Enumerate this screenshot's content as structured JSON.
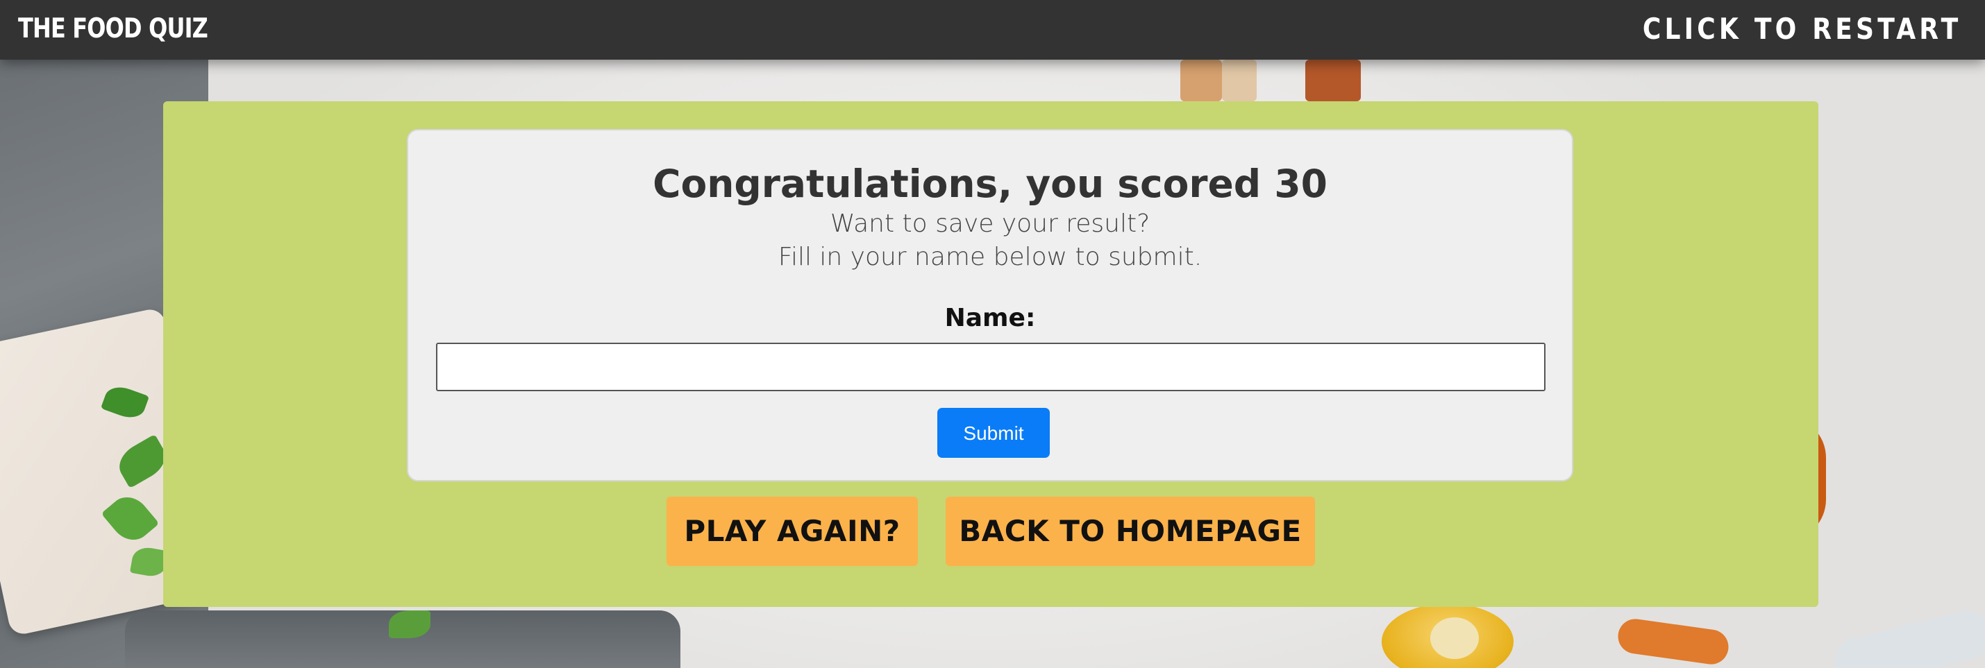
{
  "navbar": {
    "brand": "THE FOOD QUIZ",
    "restart_label": "CLICK TO RESTART"
  },
  "result": {
    "title": "Congratulations, you scored 30",
    "line1": "Want to save your result?",
    "line2": "Fill in your name below to submit.",
    "name_label": "Name:",
    "name_value": "",
    "submit_label": "Submit"
  },
  "actions": {
    "play_again": "PLAY AGAIN?",
    "back_home": "BACK TO HOMEPAGE"
  },
  "colors": {
    "navbar_bg": "#333333",
    "panel_bg": "#c6d671",
    "card_bg": "#efefef",
    "submit_bg": "#0a7cf7",
    "action_bg": "#fbb24b"
  }
}
